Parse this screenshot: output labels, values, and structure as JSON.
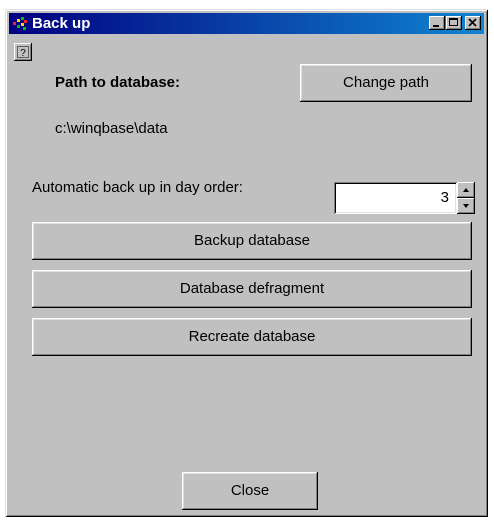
{
  "window": {
    "title": "Back up",
    "icon": "app-icon",
    "controls": [
      "minimize-icon",
      "maximize-icon",
      "close-icon"
    ]
  },
  "help": {
    "icon": "help-icon",
    "label": "?"
  },
  "path": {
    "label": "Path to database:",
    "value": "c:\\winqbase\\data",
    "change_button": "Change path"
  },
  "auto_backup": {
    "label": "Automatic back up in day order:",
    "value": "3",
    "up_icon": "arrow-up-icon",
    "down_icon": "arrow-down-icon"
  },
  "actions": {
    "backup": "Backup database",
    "defragment": "Database defragment",
    "recreate": "Recreate database"
  },
  "close_button": "Close",
  "colors": {
    "titlebar_start": "#000080",
    "titlebar_end": "#1084d0",
    "face": "#c0c0c0"
  }
}
